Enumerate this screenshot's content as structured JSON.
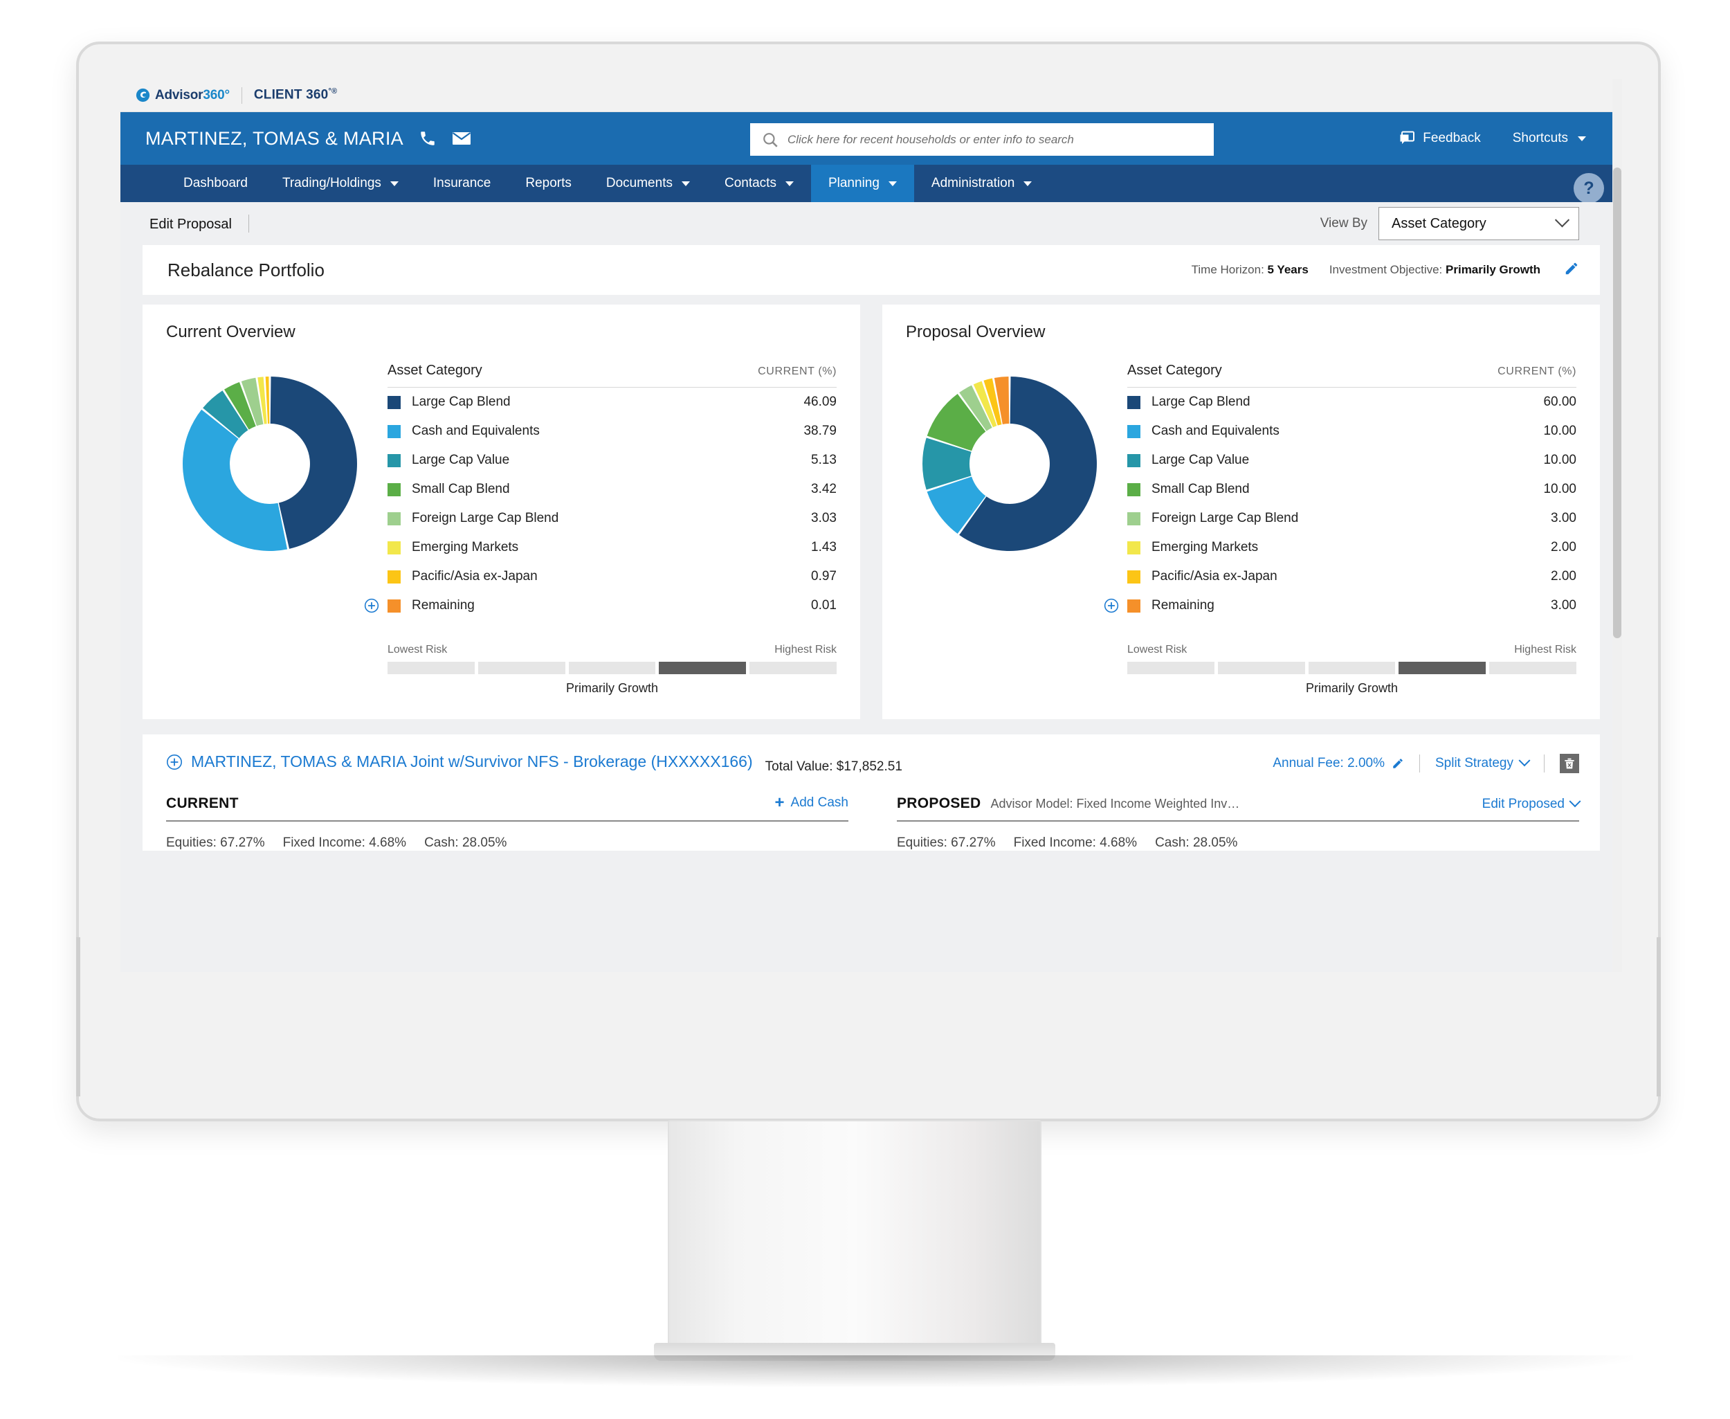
{
  "brand": {
    "logo_icon": "advisor360-swirl-icon",
    "advisor_text": "Advisor",
    "advisor_num": "360°",
    "client_text": "CLIENT 360",
    "client_deg": "°®"
  },
  "header": {
    "household_name": "MARTINEZ, TOMAS & MARIA",
    "phone_icon": "phone-icon",
    "mail_icon": "mail-icon",
    "search_placeholder": "Click here for recent households or enter info to search",
    "search_value": "",
    "search_icon": "search-icon",
    "feedback_label": "Feedback",
    "feedback_icon": "feedback-comment-icon",
    "shortcuts_label": "Shortcuts",
    "help_label": "?"
  },
  "nav": {
    "items": [
      {
        "label": "Dashboard",
        "has_caret": false,
        "active": false
      },
      {
        "label": "Trading/Holdings",
        "has_caret": true,
        "active": false
      },
      {
        "label": "Insurance",
        "has_caret": false,
        "active": false
      },
      {
        "label": "Reports",
        "has_caret": false,
        "active": false
      },
      {
        "label": "Documents",
        "has_caret": true,
        "active": false
      },
      {
        "label": "Contacts",
        "has_caret": true,
        "active": false
      },
      {
        "label": "Planning",
        "has_caret": true,
        "active": true
      },
      {
        "label": "Administration",
        "has_caret": true,
        "active": false
      }
    ]
  },
  "subbar": {
    "edit_proposal_label": "Edit Proposal",
    "view_by_label": "View By",
    "view_by_value": "Asset Category",
    "view_by_options": [
      "Asset Category"
    ]
  },
  "rebalance": {
    "title": "Rebalance Portfolio",
    "time_horizon_label": "Time Horizon:",
    "time_horizon_value": "5 Years",
    "objective_label": "Investment Objective:",
    "objective_value": "Primarily Growth",
    "edit_icon": "pencil-icon"
  },
  "overviews": [
    {
      "title": "Current Overview",
      "col_category": "Asset Category",
      "col_value": "CURRENT (%)",
      "risk": {
        "lowest_label": "Lowest Risk",
        "highest_label": "Highest Risk",
        "segments": 5,
        "active_index": 3,
        "caption": "Primarily Growth"
      }
    },
    {
      "title": "Proposal Overview",
      "col_category": "Asset Category",
      "col_value": "CURRENT (%)",
      "risk": {
        "lowest_label": "Lowest Risk",
        "highest_label": "Highest Risk",
        "segments": 5,
        "active_index": 3,
        "caption": "Primarily Growth"
      }
    }
  ],
  "account": {
    "expand_icon": "plus-circle-icon",
    "name": "MARTINEZ, TOMAS & MARIA Joint w/Survivor NFS - Brokerage (HXXXXX166)",
    "total_value_label": "Total Value:",
    "total_value": "$17,852.51",
    "annual_fee_label": "Annual Fee: 2.00%",
    "annual_fee_icon": "pencil-icon",
    "split_strategy_label": "Split Strategy",
    "delete_icon": "trash-icon",
    "current": {
      "title": "CURRENT",
      "action_label": "Add Cash",
      "action_icon": "plus-icon",
      "stats": [
        "Equities: 67.27%",
        "Fixed Income: 4.68%",
        "Cash: 28.05%"
      ]
    },
    "proposed": {
      "title": "PROPOSED",
      "subtitle": "Advisor Model: Fixed Income Weighted Inv…",
      "action_label": "Edit Proposed",
      "action_icon": "chevron-down-icon",
      "stats": [
        "Equities: 67.27%",
        "Fixed Income: 4.68%",
        "Cash: 28.05%"
      ]
    }
  },
  "colors": {
    "header_blue": "#1b6cb0",
    "nav_blue": "#1c4b82",
    "active_tab_blue": "#1b78c0",
    "link_blue": "#1b7ad1",
    "page_gray": "#eff0f2",
    "palette": [
      "#1b4878",
      "#2ba6df",
      "#2696a8",
      "#5bae47",
      "#9ecf8e",
      "#f2e74b",
      "#fcc516",
      "#f5902a"
    ]
  },
  "chart_data": [
    {
      "type": "pie",
      "title": "Current Overview",
      "subtype": "donut",
      "start_angle_deg": 0,
      "direction": "clockwise",
      "inner_radius_ratio": 0.45,
      "legend_position": "right",
      "value_unit": "%",
      "labels": [
        "Large Cap Blend",
        "Cash and Equivalents",
        "Large Cap Value",
        "Small Cap Blend",
        "Foreign Large Cap Blend",
        "Emerging Markets",
        "Pacific/Asia ex-Japan",
        "Remaining"
      ],
      "values": [
        46.09,
        38.79,
        5.13,
        3.42,
        3.03,
        1.43,
        0.97,
        0.01
      ],
      "value_strings": [
        "46.09",
        "38.79",
        "5.13",
        "3.42",
        "3.03",
        "1.43",
        "0.97",
        "0.01"
      ],
      "colors": [
        "#1b4878",
        "#2ba6df",
        "#2696a8",
        "#5bae47",
        "#9ecf8e",
        "#f2e74b",
        "#fcc516",
        "#f5902a"
      ]
    },
    {
      "type": "pie",
      "title": "Proposal Overview",
      "subtype": "donut",
      "start_angle_deg": 0,
      "direction": "clockwise",
      "inner_radius_ratio": 0.45,
      "legend_position": "right",
      "value_unit": "%",
      "labels": [
        "Large Cap Blend",
        "Cash and Equivalents",
        "Large Cap Value",
        "Small Cap Blend",
        "Foreign Large Cap Blend",
        "Emerging Markets",
        "Pacific/Asia ex-Japan",
        "Remaining"
      ],
      "values": [
        60.0,
        10.0,
        10.0,
        10.0,
        3.0,
        2.0,
        2.0,
        3.0
      ],
      "value_strings": [
        "60.00",
        "10.00",
        "10.00",
        "10.00",
        "3.00",
        "2.00",
        "2.00",
        "3.00"
      ],
      "colors": [
        "#1b4878",
        "#2ba6df",
        "#2696a8",
        "#5bae47",
        "#9ecf8e",
        "#f2e74b",
        "#fcc516",
        "#f5902a"
      ]
    }
  ]
}
